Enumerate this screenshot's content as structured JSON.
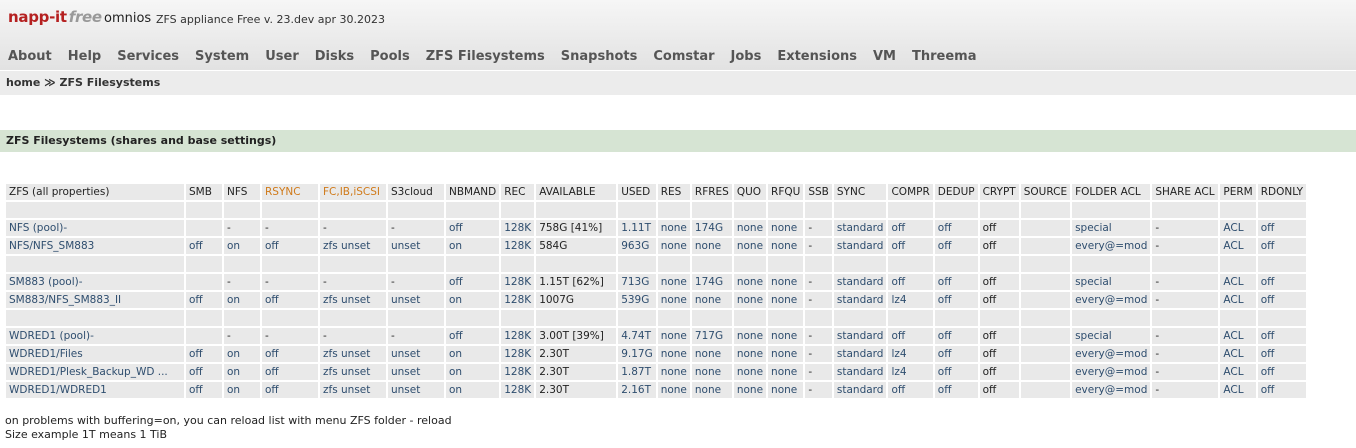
{
  "header": {
    "logo_napp": "napp-it",
    "logo_free": "free",
    "os": "omnios",
    "version": "ZFS appliance Free v. 23.dev apr 30.2023"
  },
  "menu": [
    "About",
    "Help",
    "Services",
    "System",
    "User",
    "Disks",
    "Pools",
    "ZFS Filesystems",
    "Snapshots",
    "Comstar",
    "Jobs",
    "Extensions",
    "VM",
    "Threema"
  ],
  "breadcrumb": "home ≫ ZFS Filesystems",
  "section_title": "ZFS Filesystems (shares and base settings)",
  "columns": [
    "ZFS (all properties)",
    "SMB",
    "NFS",
    "RSYNC",
    "FC,IB,iSCSI",
    "S3cloud",
    "NBMAND",
    "REC",
    "AVAILABLE",
    "USED",
    "RES",
    "RFRES",
    "QUO",
    "RFQU",
    "SSB",
    "SYNC",
    "COMPR",
    "DEDUP",
    "CRYPT",
    "SOURCE",
    "FOLDER ACL",
    "SHARE ACL",
    "PERM",
    "RDONLY"
  ],
  "rows": [
    {
      "spacer": true
    },
    {
      "cells": [
        "NFS (pool)-",
        "",
        "-",
        "-",
        "-",
        "-",
        "off",
        "128K",
        "758G [41%]",
        "1.11T",
        "none",
        "174G",
        "none",
        "none",
        "-",
        "standard",
        "off",
        "off",
        "off",
        "",
        "special",
        "-",
        "ACL",
        "off"
      ]
    },
    {
      "cells": [
        "NFS/NFS_SM883",
        "off",
        "on",
        "off",
        "zfs unset",
        "unset",
        "on",
        "128K",
        "584G",
        "963G",
        "none",
        "none",
        "none",
        "none",
        "-",
        "standard",
        "off",
        "off",
        "off",
        "",
        "every@=mod",
        "-",
        "ACL",
        "off"
      ]
    },
    {
      "spacer": true
    },
    {
      "cells": [
        "SM883 (pool)-",
        "",
        "-",
        "-",
        "-",
        "-",
        "off",
        "128K",
        "1.15T [62%]",
        "713G",
        "none",
        "174G",
        "none",
        "none",
        "-",
        "standard",
        "off",
        "off",
        "off",
        "",
        "special",
        "-",
        "ACL",
        "off"
      ]
    },
    {
      "cells": [
        "SM883/NFS_SM883_II",
        "off",
        "on",
        "off",
        "zfs unset",
        "unset",
        "on",
        "128K",
        "1007G",
        "539G",
        "none",
        "none",
        "none",
        "none",
        "-",
        "standard",
        "lz4",
        "off",
        "off",
        "",
        "every@=mod",
        "-",
        "ACL",
        "off"
      ]
    },
    {
      "spacer": true
    },
    {
      "cells": [
        "WDRED1 (pool)-",
        "",
        "-",
        "-",
        "-",
        "-",
        "off",
        "128K",
        "3.00T [39%]",
        "4.74T",
        "none",
        "717G",
        "none",
        "none",
        "-",
        "standard",
        "off",
        "off",
        "off",
        "",
        "special",
        "-",
        "ACL",
        "off"
      ]
    },
    {
      "cells": [
        "WDRED1/Files",
        "off",
        "on",
        "off",
        "zfs unset",
        "unset",
        "on",
        "128K",
        "2.30T",
        "9.17G",
        "none",
        "none",
        "none",
        "none",
        "-",
        "standard",
        "lz4",
        "off",
        "off",
        "",
        "every@=mod",
        "-",
        "ACL",
        "off"
      ]
    },
    {
      "cells": [
        "WDRED1/Plesk_Backup_WD ...",
        "off",
        "on",
        "off",
        "zfs unset",
        "unset",
        "on",
        "128K",
        "2.30T",
        "1.87T",
        "none",
        "none",
        "none",
        "none",
        "-",
        "standard",
        "lz4",
        "off",
        "off",
        "",
        "every@=mod",
        "-",
        "ACL",
        "off"
      ]
    },
    {
      "cells": [
        "WDRED1/WDRED1",
        "off",
        "on",
        "off",
        "zfs unset",
        "unset",
        "on",
        "128K",
        "2.30T",
        "2.16T",
        "none",
        "none",
        "none",
        "none",
        "-",
        "standard",
        "off",
        "off",
        "off",
        "",
        "every@=mod",
        "-",
        "ACL",
        "off"
      ]
    }
  ],
  "footer_lines": [
    "on problems with buffering=on, you can reload list with menu ZFS folder - reload",
    "Size example 1T means 1 TiB"
  ],
  "colors": {
    "link": "#2e4d6e",
    "accent_orange": "#d07a1a",
    "logo_red": "#b52020",
    "section_bg": "#d6e4d3"
  }
}
